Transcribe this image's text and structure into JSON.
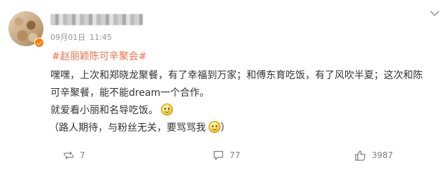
{
  "author": {
    "date": "09月01日",
    "time": "11:45"
  },
  "post": {
    "hashtag": "#赵丽颖陈可辛聚会#",
    "lines": [
      "嘿嘿，上次和郑晓龙聚餐，有了幸福到万家；和傅东育吃饭，有了风吹半夏；这次和陈",
      "可辛聚餐，能不能dream一个合作。",
      "就爱看小丽和名导吃饭。",
      "（路人期待，与粉丝无关，要骂骂我",
      "）"
    ]
  },
  "actions": {
    "repost_count": "7",
    "comment_count": "77",
    "like_count": "3987"
  },
  "colors": {
    "hashtag": "#eb7350",
    "text": "#333333",
    "meta": "#939393",
    "verify_badge": "#ff7a00"
  },
  "icons": [
    "avatar",
    "verified-badge-icon",
    "chevron-down-icon",
    "smile-emoji-icon",
    "repost-icon",
    "comment-icon",
    "like-icon"
  ]
}
